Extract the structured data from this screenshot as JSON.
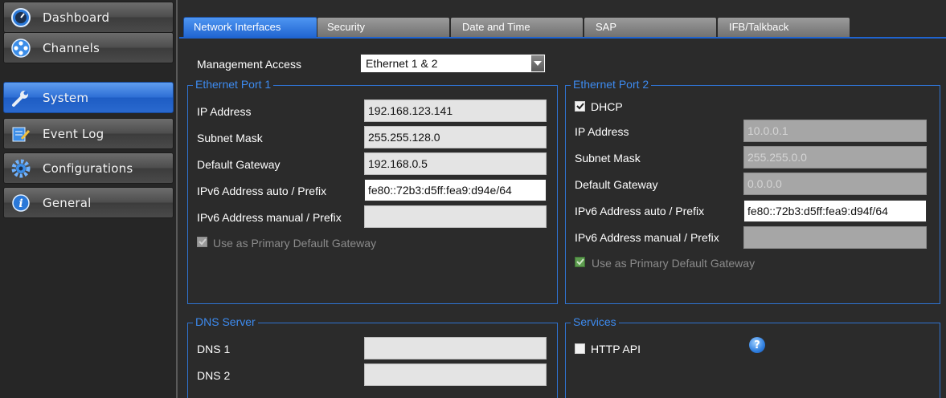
{
  "sidebar": {
    "items": [
      {
        "label": "Dashboard",
        "icon": "dashboard-gauge-icon"
      },
      {
        "label": "Channels",
        "icon": "film-reel-icon"
      },
      {
        "label": "System",
        "icon": "wrench-icon",
        "active": true
      },
      {
        "label": "Event Log",
        "icon": "notepad-pencil-icon"
      },
      {
        "label": "Configurations",
        "icon": "gear-icon"
      },
      {
        "label": "General",
        "icon": "info-icon"
      }
    ]
  },
  "tabs": [
    {
      "label": "Network Interfaces",
      "active": true
    },
    {
      "label": "Security"
    },
    {
      "label": "Date and Time"
    },
    {
      "label": "SAP"
    },
    {
      "label": "IFB/Talkback"
    }
  ],
  "management": {
    "label": "Management Access",
    "value": "Ethernet 1 & 2"
  },
  "eth1": {
    "legend": "Ethernet Port 1",
    "ip_label": "IP Address",
    "ip": "192.168.123.141",
    "mask_label": "Subnet Mask",
    "mask": "255.255.128.0",
    "gw_label": "Default Gateway",
    "gw": "192.168.0.5",
    "ipv6_auto_label": "IPv6 Address auto / Prefix",
    "ipv6_auto": "fe80::72b3:d5ff:fea9:d94e/64",
    "ipv6_manual_label": "IPv6 Address manual / Prefix",
    "ipv6_manual": "",
    "primary_label": "Use as Primary Default Gateway",
    "primary_checked": true
  },
  "eth2": {
    "legend": "Ethernet Port 2",
    "dhcp_label": "DHCP",
    "dhcp_checked": true,
    "ip_label": "IP Address",
    "ip": "10.0.0.1",
    "mask_label": "Subnet Mask",
    "mask": "255.255.0.0",
    "gw_label": "Default Gateway",
    "gw": "0.0.0.0",
    "ipv6_auto_label": "IPv6 Address auto / Prefix",
    "ipv6_auto": "fe80::72b3:d5ff:fea9:d94f/64",
    "ipv6_manual_label": "IPv6 Address manual / Prefix",
    "ipv6_manual": "",
    "primary_label": "Use as Primary Default Gateway",
    "primary_checked": true
  },
  "dns": {
    "legend": "DNS Server",
    "dns1_label": "DNS 1",
    "dns1": "",
    "dns2_label": "DNS 2",
    "dns2": ""
  },
  "services": {
    "legend": "Services",
    "http_api_label": "HTTP API",
    "http_api_checked": false,
    "help_icon": "help-icon"
  },
  "colors": {
    "accent": "#1f64d0",
    "legend": "#3d8bf0",
    "background": "#2b2b2b"
  }
}
